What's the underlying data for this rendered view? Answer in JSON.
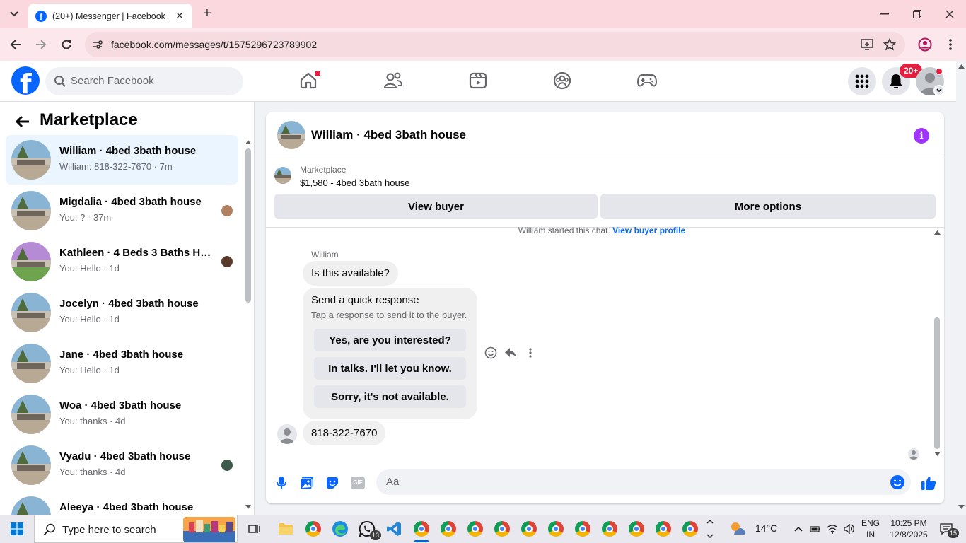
{
  "browser": {
    "tab_title": "(20+) Messenger | Facebook",
    "tab_favicon": "f",
    "url": "facebook.com/messages/t/1575296723789902"
  },
  "header": {
    "logo": "f",
    "search_placeholder": "Search Facebook",
    "notification_badge": "20+"
  },
  "sidebar": {
    "title": "Marketplace",
    "conversations": [
      {
        "name": "William · 4bed 3bath house",
        "preview": "William: 818-322-7670 · 7m",
        "active": true
      },
      {
        "name": "Migdalia · 4bed 3bath house",
        "preview": "You: ? · 37m"
      },
      {
        "name": "Kathleen · 4 Beds 3 Baths Hou...",
        "preview": "You: Hello · 1d"
      },
      {
        "name": "Jocelyn · 4bed 3bath house",
        "preview": "You: Hello · 1d"
      },
      {
        "name": "Jane · 4bed 3bath house",
        "preview": "You: Hello · 1d"
      },
      {
        "name": "Woa · 4bed 3bath house",
        "preview": "You: thanks · 4d"
      },
      {
        "name": "Vyadu · 4bed 3bath house",
        "preview": "You: thanks · 4d"
      },
      {
        "name": "Aleeya · 4bed 3bath house",
        "preview": ""
      }
    ]
  },
  "chat": {
    "title": "William · 4bed 3bath house",
    "listing_source": "Marketplace",
    "listing_title": "$1,580 - 4bed 3bath house",
    "view_buyer": "View buyer",
    "more_options": "More options",
    "system_text": "William started this chat.",
    "system_link": "View buyer profile",
    "sender_name": "William",
    "first_message": "Is this available?",
    "quick_title": "Send a quick response",
    "quick_sub": "Tap a response to send it to the buyer.",
    "quick_replies": [
      "Yes, are you interested?",
      "In talks. I'll let you know.",
      "Sorry, it's not available."
    ],
    "last_message": "818-322-7670",
    "composer_placeholder": "Aa",
    "gif_label": "GIF"
  },
  "taskbar": {
    "search_placeholder": "Type here to search",
    "whatsapp_badge": "13",
    "weather": "14°C",
    "lang1": "ENG",
    "lang2": "IN",
    "time": "10:25 PM",
    "date": "12/8/2025",
    "notification_count": "15"
  },
  "colors": {
    "brand": "#0866ff",
    "tab_strip": "#fbd7de",
    "badge_red": "#e41e3f",
    "info_purple": "#a033ff"
  }
}
